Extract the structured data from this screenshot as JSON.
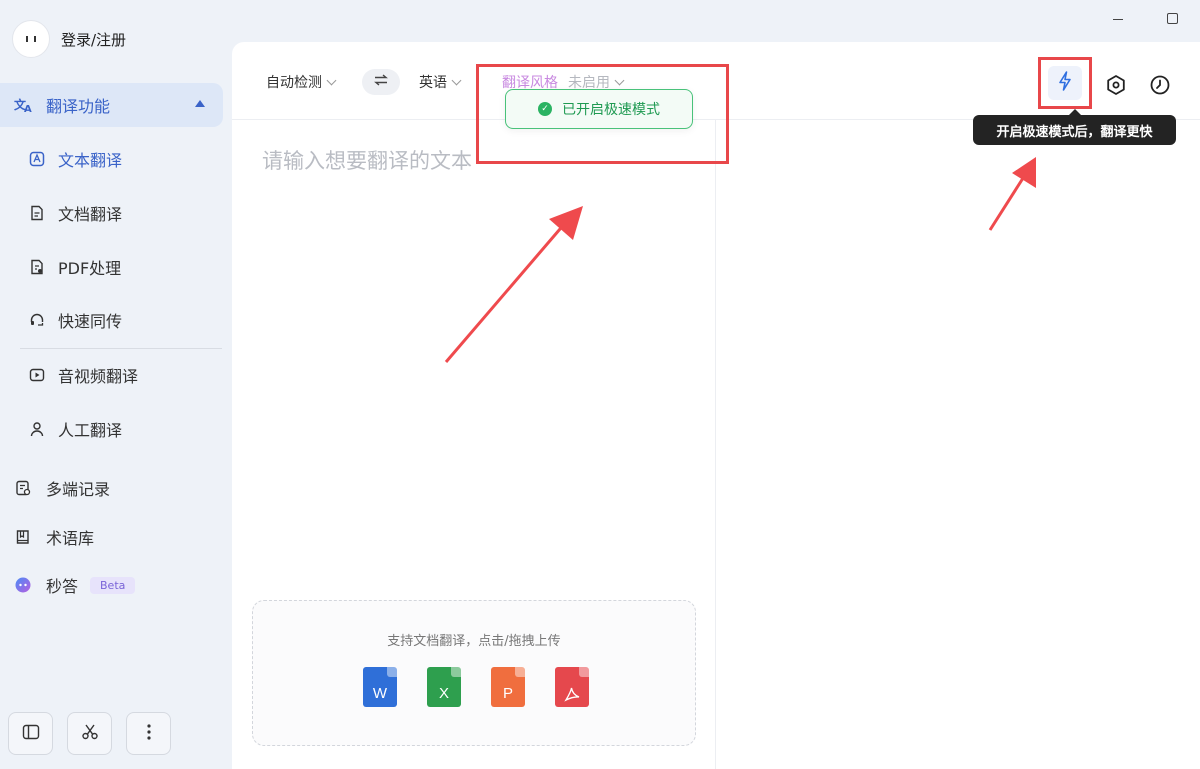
{
  "window": {
    "controls": [
      "minimize",
      "maximize"
    ]
  },
  "user": {
    "label": "登录/注册"
  },
  "sidebar": {
    "group": {
      "label": "翻译功能",
      "icon": "translate-icon"
    },
    "sub_items": [
      {
        "label": "文本翻译",
        "icon": "text-translate-icon",
        "active": true
      },
      {
        "label": "文档翻译",
        "icon": "document-icon"
      },
      {
        "label": "PDF处理",
        "icon": "pdf-icon"
      },
      {
        "label": "快速同传",
        "icon": "headset-icon"
      },
      {
        "label": "音视频翻译",
        "icon": "video-icon"
      },
      {
        "label": "人工翻译",
        "icon": "person-icon"
      }
    ],
    "items": [
      {
        "label": "多端记录",
        "icon": "record-icon"
      },
      {
        "label": "术语库",
        "icon": "book-icon"
      },
      {
        "label": "秒答",
        "icon": "ai-chat-icon",
        "badge": "Beta"
      }
    ],
    "bottom_buttons": [
      "layout-icon",
      "scissors-icon",
      "more-icon"
    ]
  },
  "toolbar": {
    "source_lang": "自动检测",
    "target_lang": "英语",
    "style_label": "翻译风格",
    "style_value": "未启用"
  },
  "editor": {
    "placeholder": "请输入想要翻译的文本",
    "upload_text": "支持文档翻译，点击/拖拽上传",
    "file_types": [
      {
        "letter": "W",
        "color": "#2f6fd8"
      },
      {
        "letter": "X",
        "color": "#2e9f4e"
      },
      {
        "letter": "P",
        "color": "#f06e3e"
      },
      {
        "letter": "",
        "color": "#e5484d"
      }
    ]
  },
  "toast": {
    "text": "已开启极速模式"
  },
  "tooltip": {
    "text": "开启极速模式后，翻译更快"
  },
  "colors": {
    "accent": "#3a63c8",
    "annotation": "#e8474a",
    "success": "#1f9a52"
  }
}
